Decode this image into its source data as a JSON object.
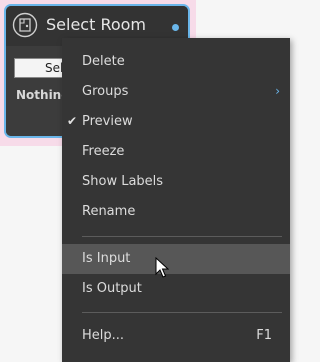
{
  "node": {
    "title": "Select Room",
    "select_button_label": "Select",
    "status_text": "Nothing",
    "accent_color": "#6ab6ea",
    "icon": "room-icon"
  },
  "context_menu": {
    "items": [
      {
        "label": "Delete"
      },
      {
        "label": "Groups",
        "has_submenu": true
      },
      {
        "label": "Preview",
        "checked": true
      },
      {
        "label": "Freeze"
      },
      {
        "label": "Show Labels"
      },
      {
        "label": "Rename"
      },
      {
        "label": "Is Input",
        "hovered": true
      },
      {
        "label": "Is Output"
      },
      {
        "label": "Help...",
        "shortcut": "F1"
      }
    ]
  },
  "cursor": {
    "icon": "arrow-cursor-icon"
  }
}
